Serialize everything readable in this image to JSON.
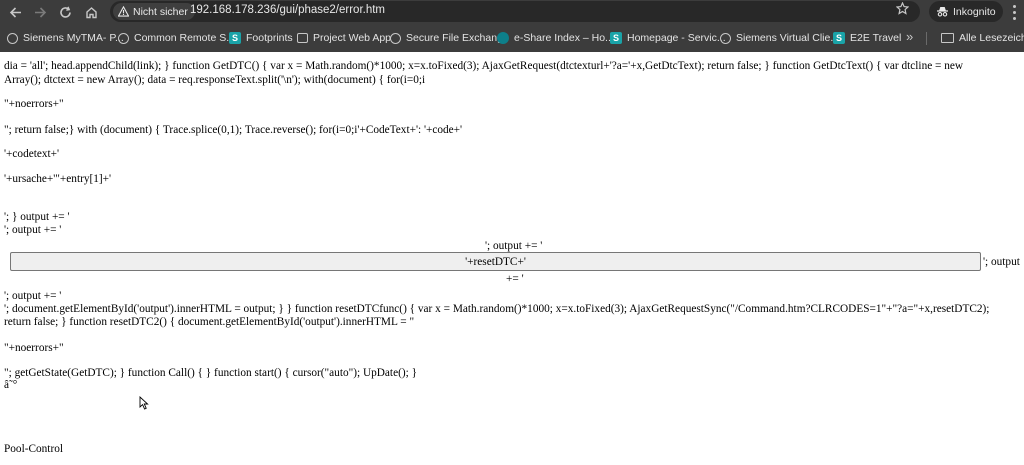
{
  "browser": {
    "security_label": "Nicht sicher",
    "url": "192.168.178.236/gui/phase2/error.htm",
    "profile_label": "Inkognito",
    "bookmarks": [
      {
        "label": "Siemens MyTMA- P...",
        "icon": "globe-icon"
      },
      {
        "label": "Common Remote S...",
        "icon": "globe-icon"
      },
      {
        "label": "Footprints",
        "icon": "s-logo-icon"
      },
      {
        "label": "Project Web App",
        "icon": "project-icon"
      },
      {
        "label": "Secure File Exchange",
        "icon": "globe-icon"
      },
      {
        "label": "e-Share Index – Ho...",
        "icon": "share-icon"
      },
      {
        "label": "Homepage - Servic...",
        "icon": "s-logo-icon"
      },
      {
        "label": "Siemens Virtual Clie...",
        "icon": "swirl-icon"
      },
      {
        "label": "E2E Travel",
        "icon": "s-logo-icon"
      }
    ],
    "all_bookmarks_label": "Alle Lesezeichen",
    "colors": {
      "chrome": "#3c3c3c",
      "omnibox": "#282828",
      "brand_s": "#1aa3a8"
    }
  },
  "page": {
    "lines": [
      "dia = 'all'; head.appendChild(link); } function GetDTC() { var x = Math.random()*1000; x=x.toFixed(3); AjaxGetRequest(dtctexturl+'?a='+x,GetDtcText); return false; } function GetDtcText() { var dtcline = new",
      "Array(); dtctext = new Array(); data = req.responseText.split('\\n'); with(document) { for(i=0;i",
      "\"+noerrors+\"",
      "\"; return false;} with (document) { Trace.splice(0,1); Trace.reverse(); for(i=0;i'+CodeText+': '+code+'",
      "'+codetext+'",
      "'+ursache+'\"+entry[1]+'",
      "'; } output += '",
      "'; output += '",
      "'; output += '",
      "'; output",
      "+= '",
      "'; output += '",
      "'; document.getElementById('output').innerHTML = output; } } function resetDTCfunc() { var x = Math.random()*1000; x=x.toFixed(3); AjaxGetRequestSync(\"/Command.htm?CLRCODES=1\"+\"?a=\"+x,resetDTC2);",
      "return false; } function resetDTC2() { document.getElementById('output').innerHTML = \"",
      "\"+noerrors+\"",
      "\"; getGetState(GetDTC); } function Call() { } function start() { cursor(\"auto\"); UpDate(); }",
      "â˜°",
      "Pool-Control"
    ],
    "reset_button_label": "'+resetDTC+'"
  }
}
